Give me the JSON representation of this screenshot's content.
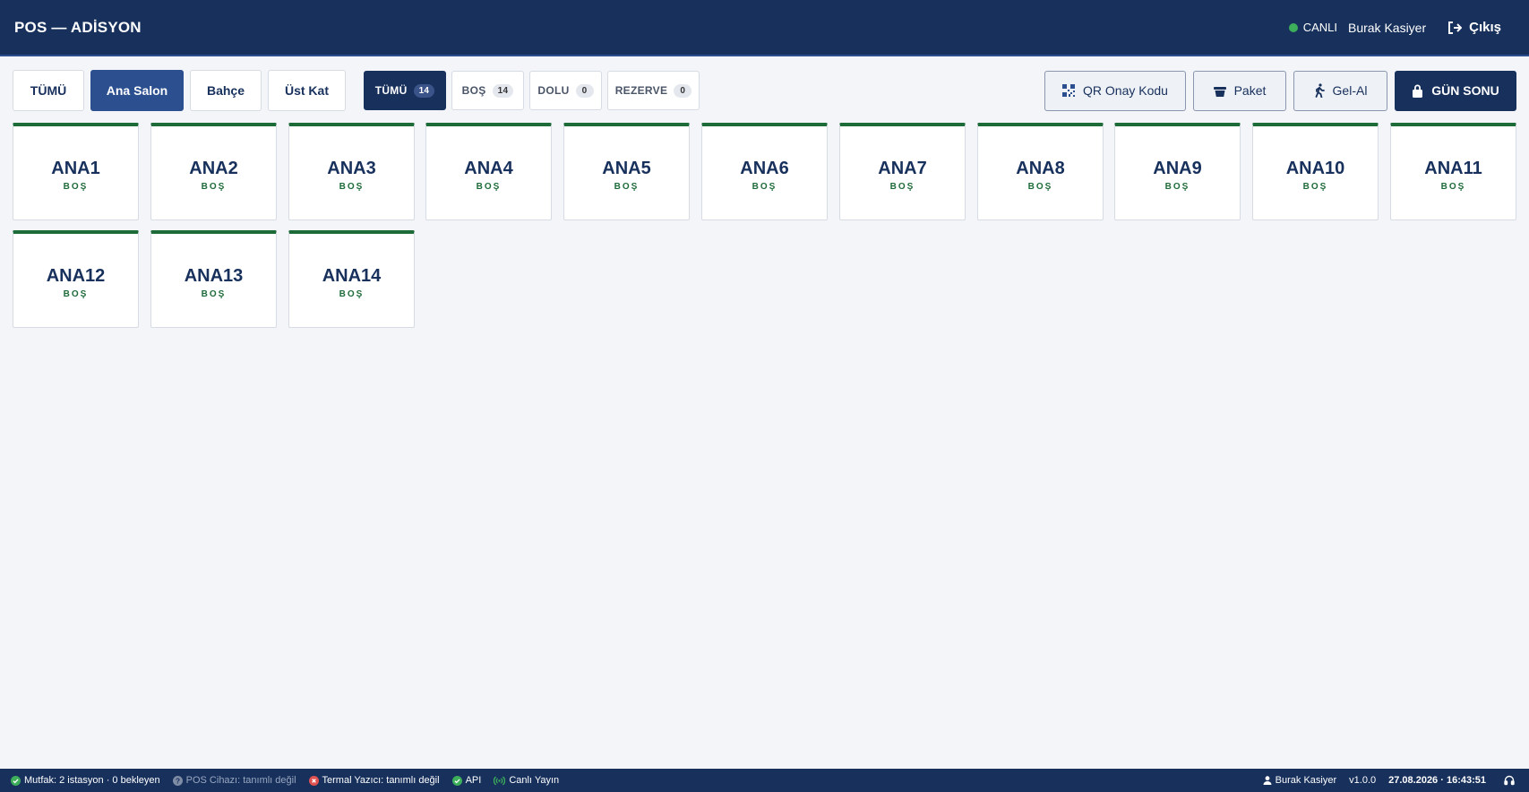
{
  "header": {
    "title": "POS — ADİSYON",
    "live_label": "CANLI",
    "user": "Burak Kasiyer",
    "logout_label": "Çıkış"
  },
  "areas": [
    {
      "label": "TÜMÜ",
      "active": false
    },
    {
      "label": "Ana Salon",
      "active": true
    },
    {
      "label": "Bahçe",
      "active": false
    },
    {
      "label": "Üst Kat",
      "active": false
    }
  ],
  "filters": [
    {
      "label": "TÜMÜ",
      "count": "14",
      "active": true
    },
    {
      "label": "BOŞ",
      "count": "14",
      "active": false
    },
    {
      "label": "DOLU",
      "count": "0",
      "active": false
    },
    {
      "label": "REZERVE",
      "count": "0",
      "active": false
    }
  ],
  "actions": {
    "qr": {
      "label": "QR Onay Kodu",
      "icon": "qr-code-icon"
    },
    "package": {
      "label": "Paket",
      "icon": "basket-icon"
    },
    "takeaway": {
      "label": "Gel-Al",
      "icon": "walking-person-icon"
    },
    "day_end": {
      "label": "GÜN SONU",
      "icon": "lock-icon"
    }
  },
  "tables": [
    {
      "name": "ANA1",
      "status": "BOŞ"
    },
    {
      "name": "ANA2",
      "status": "BOŞ"
    },
    {
      "name": "ANA3",
      "status": "BOŞ"
    },
    {
      "name": "ANA4",
      "status": "BOŞ"
    },
    {
      "name": "ANA5",
      "status": "BOŞ"
    },
    {
      "name": "ANA6",
      "status": "BOŞ"
    },
    {
      "name": "ANA7",
      "status": "BOŞ"
    },
    {
      "name": "ANA8",
      "status": "BOŞ"
    },
    {
      "name": "ANA9",
      "status": "BOŞ"
    },
    {
      "name": "ANA10",
      "status": "BOŞ"
    },
    {
      "name": "ANA11",
      "status": "BOŞ"
    },
    {
      "name": "ANA12",
      "status": "BOŞ"
    },
    {
      "name": "ANA13",
      "status": "BOŞ"
    },
    {
      "name": "ANA14",
      "status": "BOŞ"
    }
  ],
  "statusbar": {
    "kitchen": "Mutfak: 2 istasyon · 0 bekleyen",
    "pos_device": "POS Cihazı: tanımlı değil",
    "printer": "Termal Yazıcı: tanımlı değil",
    "api": "API",
    "live_stream": "Canlı Yayın",
    "user": "Burak Kasiyer",
    "version": "v1.0.0",
    "datetime": "27.08.2026 · 16:43:51"
  },
  "colors": {
    "navy": "#17305c",
    "active_area": "#2b4f8f",
    "free_green": "#1e6b3a",
    "ok_green": "#3dae5a",
    "error_red": "#e05252"
  }
}
